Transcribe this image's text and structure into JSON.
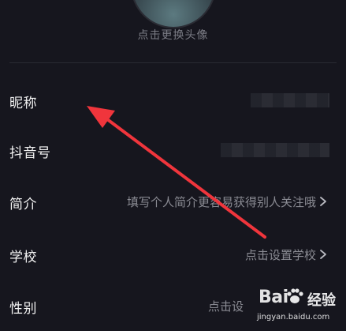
{
  "header": {
    "change_avatar_text": "点击更换头像"
  },
  "profile_rows": [
    {
      "label": "昵称",
      "value": ""
    },
    {
      "label": "抖音号",
      "value": ""
    },
    {
      "label": "简介",
      "value": "填写个人简介更容易获得别人关注哦"
    },
    {
      "label": "学校",
      "value": "点击设置学校"
    },
    {
      "label": "性别",
      "value": "点击设"
    }
  ],
  "watermark": {
    "brand": "Bai",
    "brand_suffix": "经验",
    "url": "jingyan.baidu.com"
  },
  "colors": {
    "background": "#16161e",
    "label": "#f2f2f2",
    "hint": "#8a8b93",
    "annotation_arrow": "#f0353c"
  }
}
